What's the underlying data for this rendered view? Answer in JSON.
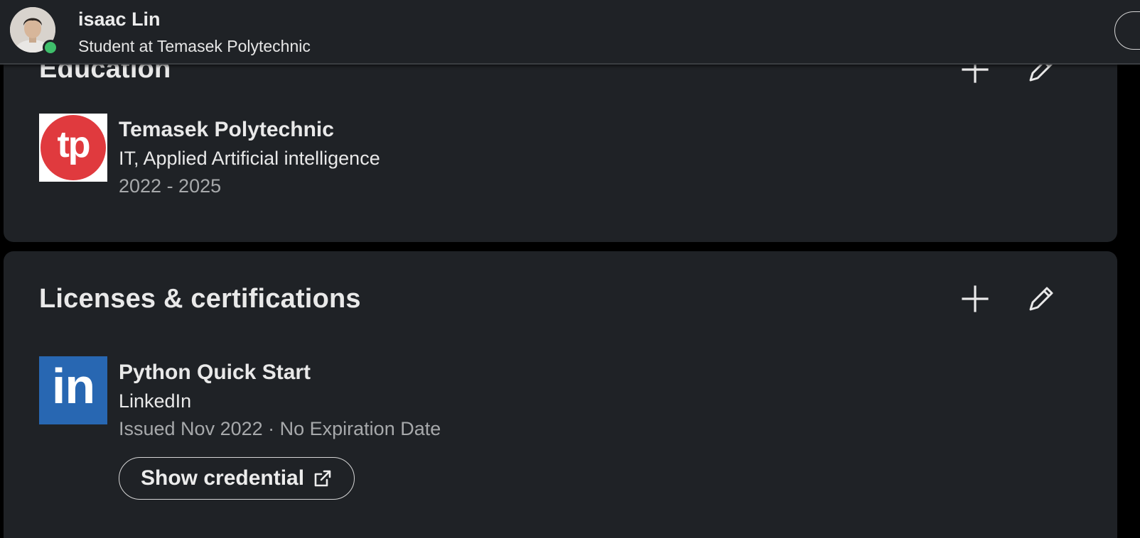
{
  "topbar": {
    "name": "isaac Lin",
    "headline": "Student at Temasek Polytechnic",
    "presence_color": "#3fbf6b"
  },
  "education": {
    "title": "Education",
    "items": [
      {
        "school": "Temasek Polytechnic",
        "degree": "IT, Applied Artificial intelligence",
        "dates": "2022 - 2025",
        "logo_text": "tp",
        "logo_color": "#e03a3e"
      }
    ]
  },
  "licenses": {
    "title": "Licenses & certifications",
    "items": [
      {
        "name": "Python Quick Start",
        "issuer": "LinkedIn",
        "meta": "Issued Nov 2022 · No Expiration Date",
        "logo_text": "in",
        "logo_color": "#2867b2",
        "button_label": "Show credential"
      }
    ]
  },
  "icons": {
    "add": "plus-icon",
    "edit": "pencil-icon",
    "external": "external-link-icon"
  }
}
